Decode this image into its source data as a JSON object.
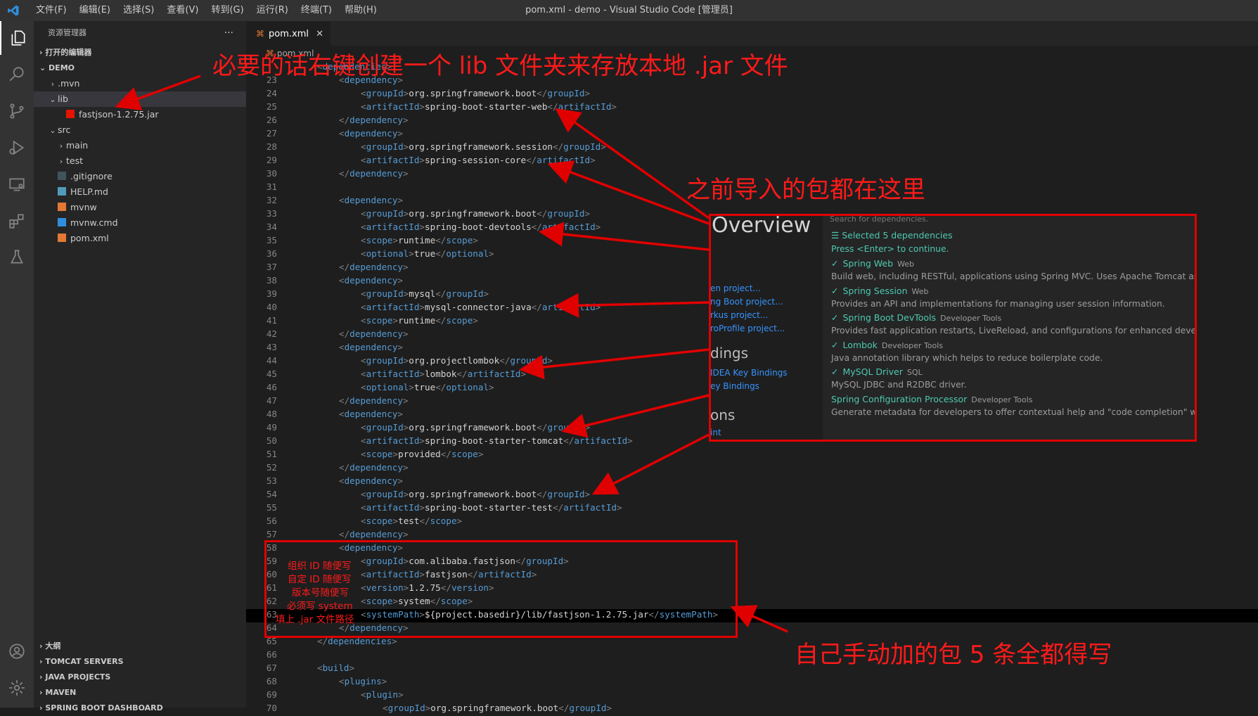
{
  "window": {
    "title": "pom.xml - demo - Visual Studio Code [管理员]",
    "menu": [
      "文件(F)",
      "编辑(E)",
      "选择(S)",
      "查看(V)",
      "转到(G)",
      "运行(R)",
      "终端(T)",
      "帮助(H)"
    ]
  },
  "sidebar": {
    "title": "资源管理器",
    "more": "···",
    "open_editors": "打开的编辑器",
    "root": "DEMO",
    "tree": [
      {
        "label": ".mvn",
        "depth": 1,
        "chev": "›",
        "icon": "folder-icon"
      },
      {
        "label": "lib",
        "depth": 1,
        "chev": "⌄",
        "icon": "folder-icon"
      },
      {
        "label": "fastjson-1.2.75.jar",
        "depth": 2,
        "chev": "",
        "icon": "jar-file-icon"
      },
      {
        "label": "src",
        "depth": 1,
        "chev": "⌄",
        "icon": "folder-icon"
      },
      {
        "label": "main",
        "depth": 2,
        "chev": "›",
        "icon": "folder-icon"
      },
      {
        "label": "test",
        "depth": 2,
        "chev": "›",
        "icon": "folder-icon"
      },
      {
        "label": ".gitignore",
        "depth": 1,
        "chev": "",
        "icon": "git-file-icon"
      },
      {
        "label": "HELP.md",
        "depth": 1,
        "chev": "",
        "icon": "markdown-file-icon"
      },
      {
        "label": "mvnw",
        "depth": 1,
        "chev": "",
        "icon": "script-file-icon"
      },
      {
        "label": "mvnw.cmd",
        "depth": 1,
        "chev": "",
        "icon": "windows-file-icon"
      },
      {
        "label": "pom.xml",
        "depth": 1,
        "chev": "",
        "icon": "xml-file-icon"
      }
    ],
    "bottom_sections": [
      "大纲",
      "TOMCAT SERVERS",
      "JAVA PROJECTS",
      "MAVEN",
      "SPRING BOOT DASHBOARD"
    ]
  },
  "editor": {
    "tab_label": "pom.xml",
    "tab_close": "✕",
    "breadcrumb": "pom.xml",
    "lines": [
      {
        "n": "",
        "indent": 1,
        "tag": "dependencies",
        "text": "",
        "close": false,
        "open": true
      },
      {
        "n": "23",
        "indent": 2,
        "tag": "dependency",
        "text": "",
        "open": true
      },
      {
        "n": "24",
        "indent": 3,
        "tag": "groupId",
        "text": "org.springframework.boot"
      },
      {
        "n": "25",
        "indent": 3,
        "tag": "artifactId",
        "text": "spring-boot-starter-web"
      },
      {
        "n": "26",
        "indent": 2,
        "tag": "/dependency",
        "text": "",
        "open": true
      },
      {
        "n": "27",
        "indent": 2,
        "tag": "dependency",
        "text": "",
        "open": true
      },
      {
        "n": "28",
        "indent": 3,
        "tag": "groupId",
        "text": "org.springframework.session"
      },
      {
        "n": "29",
        "indent": 3,
        "tag": "artifactId",
        "text": "spring-session-core"
      },
      {
        "n": "30",
        "indent": 2,
        "tag": "/dependency",
        "text": "",
        "open": true
      },
      {
        "n": "31",
        "indent": 0,
        "tag": "",
        "text": ""
      },
      {
        "n": "32",
        "indent": 2,
        "tag": "dependency",
        "text": "",
        "open": true
      },
      {
        "n": "33",
        "indent": 3,
        "tag": "groupId",
        "text": "org.springframework.boot"
      },
      {
        "n": "34",
        "indent": 3,
        "tag": "artifactId",
        "text": "spring-boot-devtools"
      },
      {
        "n": "35",
        "indent": 3,
        "tag": "scope",
        "text": "runtime"
      },
      {
        "n": "36",
        "indent": 3,
        "tag": "optional",
        "text": "true"
      },
      {
        "n": "37",
        "indent": 2,
        "tag": "/dependency",
        "text": "",
        "open": true
      },
      {
        "n": "38",
        "indent": 2,
        "tag": "dependency",
        "text": "",
        "open": true
      },
      {
        "n": "39",
        "indent": 3,
        "tag": "groupId",
        "text": "mysql"
      },
      {
        "n": "40",
        "indent": 3,
        "tag": "artifactId",
        "text": "mysql-connector-java"
      },
      {
        "n": "41",
        "indent": 3,
        "tag": "scope",
        "text": "runtime"
      },
      {
        "n": "42",
        "indent": 2,
        "tag": "/dependency",
        "text": "",
        "open": true
      },
      {
        "n": "43",
        "indent": 2,
        "tag": "dependency",
        "text": "",
        "open": true
      },
      {
        "n": "44",
        "indent": 3,
        "tag": "groupId",
        "text": "org.projectlombok"
      },
      {
        "n": "45",
        "indent": 3,
        "tag": "artifactId",
        "text": "lombok"
      },
      {
        "n": "46",
        "indent": 3,
        "tag": "optional",
        "text": "true"
      },
      {
        "n": "47",
        "indent": 2,
        "tag": "/dependency",
        "text": "",
        "open": true
      },
      {
        "n": "48",
        "indent": 2,
        "tag": "dependency",
        "text": "",
        "open": true
      },
      {
        "n": "49",
        "indent": 3,
        "tag": "groupId",
        "text": "org.springframework.boot"
      },
      {
        "n": "50",
        "indent": 3,
        "tag": "artifactId",
        "text": "spring-boot-starter-tomcat"
      },
      {
        "n": "51",
        "indent": 3,
        "tag": "scope",
        "text": "provided"
      },
      {
        "n": "52",
        "indent": 2,
        "tag": "/dependency",
        "text": "",
        "open": true
      },
      {
        "n": "53",
        "indent": 2,
        "tag": "dependency",
        "text": "",
        "open": true
      },
      {
        "n": "54",
        "indent": 3,
        "tag": "groupId",
        "text": "org.springframework.boot"
      },
      {
        "n": "55",
        "indent": 3,
        "tag": "artifactId",
        "text": "spring-boot-starter-test"
      },
      {
        "n": "56",
        "indent": 3,
        "tag": "scope",
        "text": "test"
      },
      {
        "n": "57",
        "indent": 2,
        "tag": "/dependency",
        "text": "",
        "open": true
      },
      {
        "n": "58",
        "indent": 2,
        "tag": "dependency",
        "text": "",
        "open": true
      },
      {
        "n": "59",
        "indent": 3,
        "tag": "groupId",
        "text": "com.alibaba.fastjson"
      },
      {
        "n": "60",
        "indent": 3,
        "tag": "artifactId",
        "text": "fastjson"
      },
      {
        "n": "61",
        "indent": 3,
        "tag": "version",
        "text": "1.2.75"
      },
      {
        "n": "62",
        "indent": 3,
        "tag": "scope",
        "text": "system"
      },
      {
        "n": "63",
        "indent": 3,
        "tag": "systemPath",
        "text": "${project.basedir}/lib/fastjson-1.2.75.jar"
      },
      {
        "n": "64",
        "indent": 2,
        "tag": "/dependency",
        "text": "",
        "open": true
      },
      {
        "n": "65",
        "indent": 1,
        "tag": "/dependencies",
        "text": "",
        "open": true
      },
      {
        "n": "66",
        "indent": 0,
        "tag": "",
        "text": ""
      },
      {
        "n": "67",
        "indent": 1,
        "tag": "build",
        "text": "",
        "open": true
      },
      {
        "n": "68",
        "indent": 2,
        "tag": "plugins",
        "text": "",
        "open": true
      },
      {
        "n": "69",
        "indent": 3,
        "tag": "plugin",
        "text": "",
        "open": true
      },
      {
        "n": "70",
        "indent": 4,
        "tag": "groupId",
        "text": "org.springframework.boot"
      }
    ]
  },
  "overlay": {
    "title": "Overview",
    "links": [
      "en project...",
      "ng Boot project...",
      "rkus project...",
      "roProfile project..."
    ],
    "heading2": "dings",
    "links2": [
      "IDEA Key Bindings",
      "ey Bindings"
    ],
    "heading3": "ons",
    "link3": "int",
    "search_placeholder": "Search for dependencies.",
    "selected": "Selected 5 dependencies",
    "press_enter": "Press <Enter> to continue.",
    "deps": [
      {
        "name": "Spring Web",
        "cat": "Web",
        "desc": "Build web, including RESTful, applications using Spring MVC. Uses Apache Tomcat as the d",
        "checked": true
      },
      {
        "name": "Spring Session",
        "cat": "Web",
        "desc": "Provides an API and implementations for managing user session information.",
        "checked": true
      },
      {
        "name": "Spring Boot DevTools",
        "cat": "Developer Tools",
        "desc": "Provides fast application restarts, LiveReload, and configurations for enhanced developme",
        "checked": true
      },
      {
        "name": "Lombok",
        "cat": "Developer Tools",
        "desc": "Java annotation library which helps to reduce boilerplate code.",
        "checked": true
      },
      {
        "name": "MySQL Driver",
        "cat": "SQL",
        "desc": "MySQL JDBC and R2DBC driver.",
        "checked": true
      },
      {
        "name": "Spring Configuration Processor",
        "cat": "Developer Tools",
        "desc": "Generate metadata for developers to offer contextual help and \"code completion\" when w",
        "checked": false
      }
    ]
  },
  "annotations": {
    "top": "必要的话右键创建一个 lib 文件夹来存放本地 .jar 文件",
    "middle": "之前导入的包都在这里",
    "bottom": "自己手动加的包 5 条全都得写",
    "side_labels": [
      "组织 ID 随便写",
      "自定 ID 随便写",
      "版本号随便写",
      "必须写 system",
      "填上 .jar 文件路径"
    ]
  },
  "colors": {
    "annotation": "#ff1a1a",
    "accent_green": "#4ec9b0",
    "tag_blue": "#569cd6"
  }
}
